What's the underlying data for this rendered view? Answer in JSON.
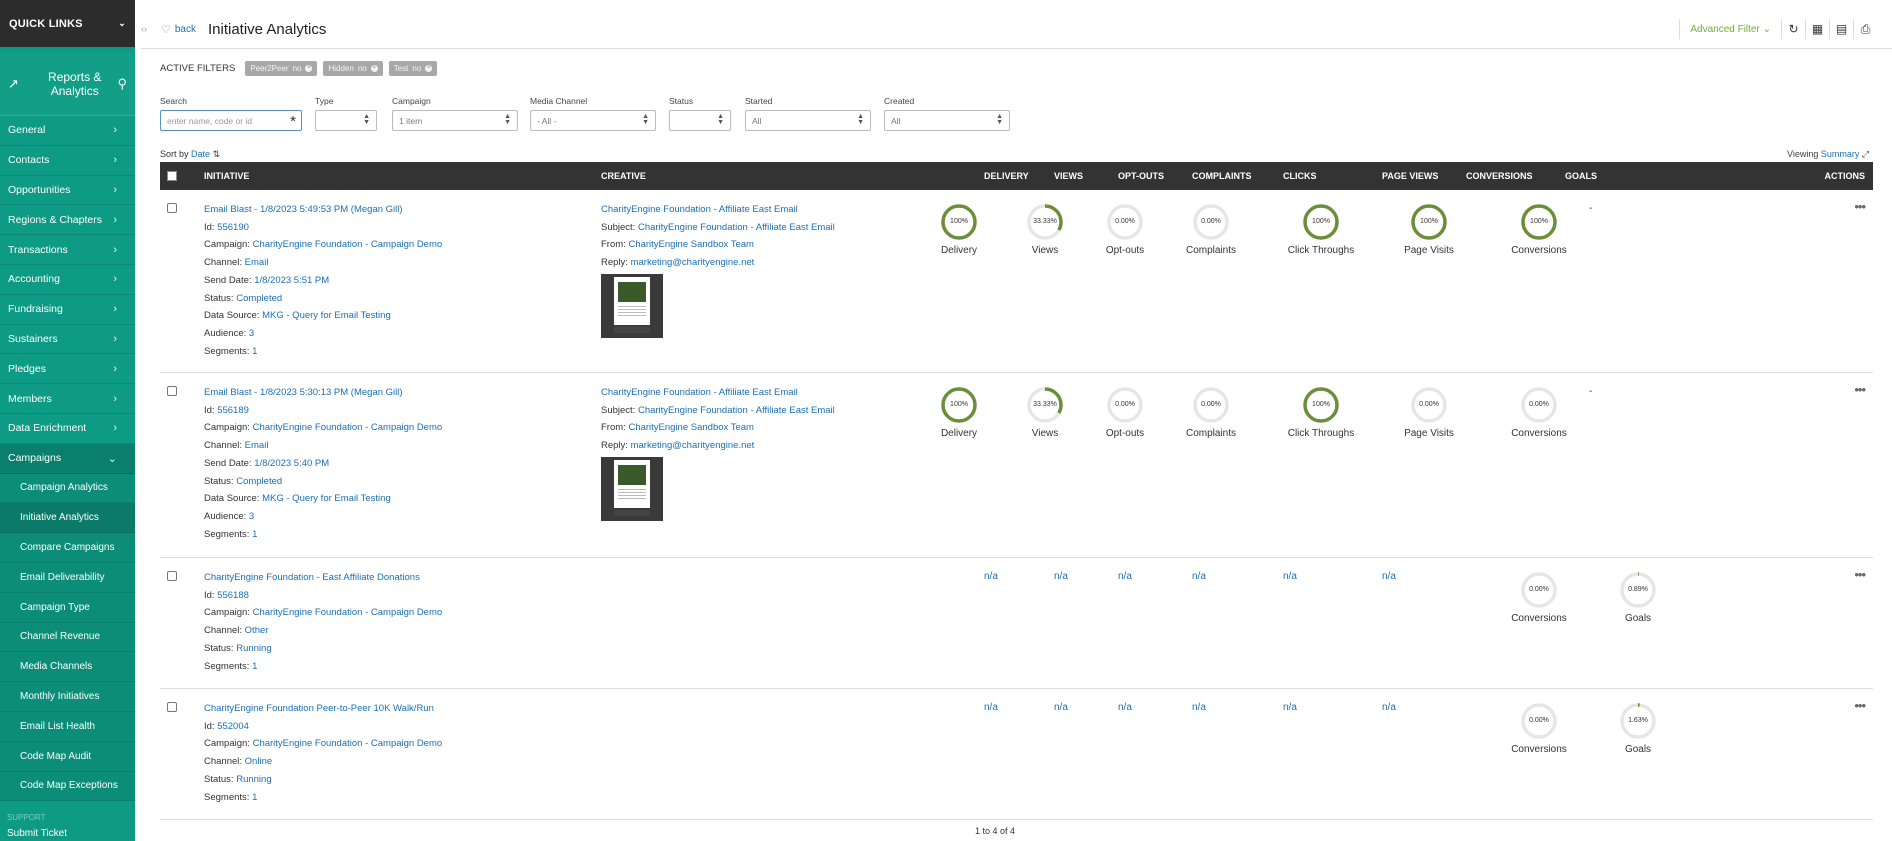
{
  "sidebar": {
    "quick_links": "QUICK LINKS",
    "section_title": "Reports & Analytics",
    "nav": [
      "General",
      "Contacts",
      "Opportunities",
      "Regions & Chapters",
      "Transactions",
      "Accounting",
      "Fundraising",
      "Sustainers",
      "Pledges",
      "Members",
      "Data Enrichment",
      "Campaigns"
    ],
    "sub": [
      "Campaign Analytics",
      "Initiative Analytics",
      "Compare Campaigns",
      "Email Deliverability",
      "Campaign Type",
      "Channel Revenue",
      "Media Channels",
      "Monthly Initiatives",
      "Email List Health",
      "Code Map Audit",
      "Code Map Exceptions"
    ],
    "support": "SUPPORT",
    "ticket": "Submit Ticket"
  },
  "header": {
    "back": "back",
    "title": "Initiative Analytics",
    "advanced_filter": "Advanced Filter"
  },
  "active_filters": {
    "label": "ACTIVE FILTERS",
    "chips": [
      {
        "name": "Peer2Peer",
        "val": "no"
      },
      {
        "name": "Hidden",
        "val": "no"
      },
      {
        "name": "Test",
        "val": "no"
      }
    ]
  },
  "filters": {
    "search": {
      "label": "Search",
      "placeholder": "enter name, code or id"
    },
    "type": {
      "label": "Type",
      "value": ""
    },
    "campaign": {
      "label": "Campaign",
      "value": "1 item"
    },
    "media": {
      "label": "Media Channel",
      "value": "- All -"
    },
    "status": {
      "label": "Status",
      "value": ""
    },
    "started": {
      "label": "Started",
      "value": "All"
    },
    "created": {
      "label": "Created",
      "value": "All"
    }
  },
  "sort": {
    "label": "Sort by",
    "value": "Date"
  },
  "viewing": {
    "label": "Viewing",
    "value": "Summary"
  },
  "columns": [
    "INITIATIVE",
    "CREATIVE",
    "DELIVERY",
    "VIEWS",
    "OPT-OUTS",
    "COMPLAINTS",
    "CLICKS",
    "PAGE VIEWS",
    "CONVERSIONS",
    "GOALS",
    "ACTIONS"
  ],
  "keys": {
    "id": "Id:",
    "campaign": "Campaign:",
    "channel": "Channel:",
    "send_date": "Send Date:",
    "status": "Status:",
    "data_source": "Data Source:",
    "audience": "Audience:",
    "segments": "Segments:",
    "subject": "Subject:",
    "from": "From:",
    "reply": "Reply:"
  },
  "rows": [
    {
      "name": "Email Blast - 1/8/2023 5:49:53 PM (Megan Gill)",
      "id": "556190",
      "campaign": "CharityEngine Foundation - Campaign Demo",
      "channel": "Email",
      "send_date": "1/8/2023 5:51 PM",
      "status": "Completed",
      "data_source": "MKG - Query for Email Testing",
      "audience": "3",
      "segments": "1",
      "creative": {
        "title": "CharityEngine Foundation - Affiliate East Email",
        "subject": "CharityEngine Foundation - Affiliate East Email",
        "from": "CharityEngine Sandbox Team",
        "reply": "marketing@charityengine.net"
      },
      "goals": "-",
      "metrics": [
        {
          "label": "Delivery",
          "value": "100%",
          "pct": 100
        },
        {
          "label": "Views",
          "value": "33.33%",
          "pct": 33.33
        },
        {
          "label": "Opt-outs",
          "value": "0.00%",
          "pct": 0
        },
        {
          "label": "Complaints",
          "value": "0.00%",
          "pct": 0
        },
        {
          "label": "Click Throughs",
          "value": "100%",
          "pct": 100
        },
        {
          "label": "Page Visits",
          "value": "100%",
          "pct": 100
        },
        {
          "label": "Conversions",
          "value": "100%",
          "pct": 100
        }
      ]
    },
    {
      "name": "Email Blast - 1/8/2023 5:30:13 PM (Megan Gill)",
      "id": "556189",
      "campaign": "CharityEngine Foundation - Campaign Demo",
      "channel": "Email",
      "send_date": "1/8/2023 5:40 PM",
      "status": "Completed",
      "data_source": "MKG - Query for Email Testing",
      "audience": "3",
      "segments": "1",
      "creative": {
        "title": "CharityEngine Foundation - Affiliate East Email",
        "subject": "CharityEngine Foundation - Affiliate East Email",
        "from": "CharityEngine Sandbox Team",
        "reply": "marketing@charityengine.net"
      },
      "goals": "-",
      "metrics": [
        {
          "label": "Delivery",
          "value": "100%",
          "pct": 100
        },
        {
          "label": "Views",
          "value": "33.33%",
          "pct": 33.33
        },
        {
          "label": "Opt-outs",
          "value": "0.00%",
          "pct": 0
        },
        {
          "label": "Complaints",
          "value": "0.00%",
          "pct": 0
        },
        {
          "label": "Click Throughs",
          "value": "100%",
          "pct": 100
        },
        {
          "label": "Page Visits",
          "value": "0.00%",
          "pct": 0
        },
        {
          "label": "Conversions",
          "value": "0.00%",
          "pct": 0
        }
      ]
    },
    {
      "name": "CharityEngine Foundation - East Affiliate Donations",
      "id": "556188",
      "campaign": "CharityEngine Foundation - Campaign Demo",
      "channel": "Other",
      "status": "Running",
      "segments": "1",
      "na": "n/a",
      "metrics": [
        {
          "label": "Conversions",
          "value": "0.00%",
          "pct": 0
        },
        {
          "label": "Goals",
          "value": "0.89%",
          "pct": 0.89
        }
      ]
    },
    {
      "name": "CharityEngine Foundation Peer-to-Peer 10K Walk/Run",
      "id": "552004",
      "campaign": "CharityEngine Foundation - Campaign Demo",
      "channel": "Online",
      "status": "Running",
      "segments": "1",
      "na": "n/a",
      "metrics": [
        {
          "label": "Conversions",
          "value": "0.00%",
          "pct": 0
        },
        {
          "label": "Goals",
          "value": "1.63%",
          "pct": 1.63
        }
      ]
    }
  ],
  "pager": "1 to 4 of 4",
  "colors": {
    "sidebar": "#0e9b85",
    "ring": "#6b8e3a",
    "link": "#1b6fb5",
    "accent": "#6fb033"
  }
}
